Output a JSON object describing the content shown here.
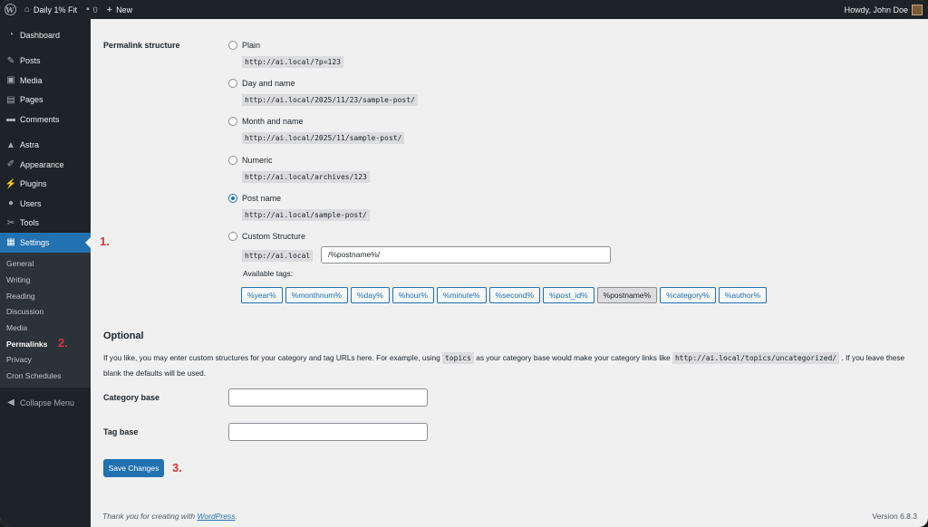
{
  "adminbar": {
    "site_name": "Daily 1% Fit",
    "comments_count": "0",
    "new_label": "New",
    "howdy": "Howdy, John Doe"
  },
  "sidebar": {
    "items": [
      {
        "label": "Dashboard",
        "icon": "dashboard-icon"
      },
      {
        "label": "Posts",
        "icon": "pin-icon"
      },
      {
        "label": "Media",
        "icon": "media-icon"
      },
      {
        "label": "Pages",
        "icon": "page-icon"
      },
      {
        "label": "Comments",
        "icon": "comment-icon"
      },
      {
        "label": "Astra",
        "icon": "astra-icon"
      },
      {
        "label": "Appearance",
        "icon": "brush-icon"
      },
      {
        "label": "Plugins",
        "icon": "plug-icon"
      },
      {
        "label": "Users",
        "icon": "user-icon"
      },
      {
        "label": "Tools",
        "icon": "wrench-icon"
      },
      {
        "label": "Settings",
        "icon": "settings-icon"
      }
    ],
    "submenu": [
      "General",
      "Writing",
      "Reading",
      "Discussion",
      "Media",
      "Permalinks",
      "Privacy",
      "Cron Schedules"
    ],
    "collapse_label": "Collapse Menu"
  },
  "steps": {
    "one": "1.",
    "two": "2.",
    "three": "3."
  },
  "permalink": {
    "label": "Permalink structure",
    "options": [
      {
        "label": "Plain",
        "example": "http://ai.local/?p=123",
        "checked": false
      },
      {
        "label": "Day and name",
        "example": "http://ai.local/2025/11/23/sample-post/",
        "checked": false
      },
      {
        "label": "Month and name",
        "example": "http://ai.local/2025/11/sample-post/",
        "checked": false
      },
      {
        "label": "Numeric",
        "example": "http://ai.local/archives/123",
        "checked": false
      },
      {
        "label": "Post name",
        "example": "http://ai.local/sample-post/",
        "checked": true
      },
      {
        "label": "Custom Structure",
        "checked": false
      }
    ],
    "custom_prefix": "http://ai.local",
    "custom_value": "/%postname%/",
    "available_tags_label": "Available tags:",
    "tags": [
      "%year%",
      "%monthnum%",
      "%day%",
      "%hour%",
      "%minute%",
      "%second%",
      "%post_id%",
      "%postname%",
      "%category%",
      "%author%"
    ]
  },
  "optional": {
    "title": "Optional",
    "para_1": "If you like, you may enter custom structures for your category and tag URLs here. For example, using",
    "code_1": "topics",
    "para_2": "as your category base would make your category links like",
    "code_2": "http://ai.local/topics/uncategorized/",
    "para_3": ". If you leave these blank the defaults will be used.",
    "category_label": "Category base",
    "tag_label": "Tag base",
    "category_value": "",
    "tag_value": ""
  },
  "save_label": "Save Changes",
  "footer": {
    "thanks": "Thank you for creating with",
    "link": "WordPress",
    "period": ".",
    "version": "Version 6.8.3"
  }
}
